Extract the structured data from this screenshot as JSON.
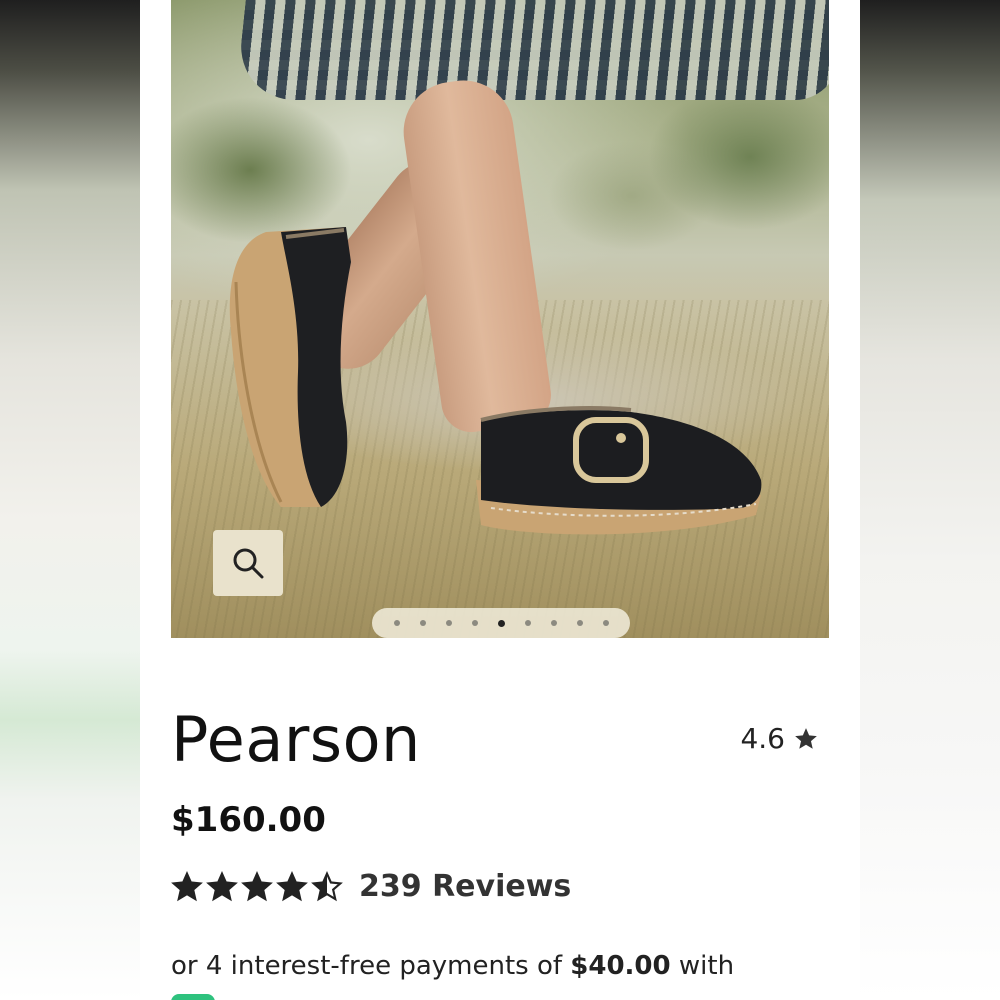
{
  "product": {
    "name": "Pearson",
    "average_rating": "4.6",
    "price": "$160.00",
    "rating_stars": 4.5,
    "reviews_label": "239 Reviews"
  },
  "gallery": {
    "image_count": 9,
    "active_index": 4,
    "zoom_icon": "search-icon"
  },
  "installments": {
    "prefix": "or 4 interest-free payments of ",
    "amount": "$40.00",
    "suffix": " with"
  },
  "colors": {
    "text": "#111111",
    "zoom_button_bg": "#e9e2cc",
    "provider_badge": "#2ec27e",
    "star": "#222222"
  }
}
